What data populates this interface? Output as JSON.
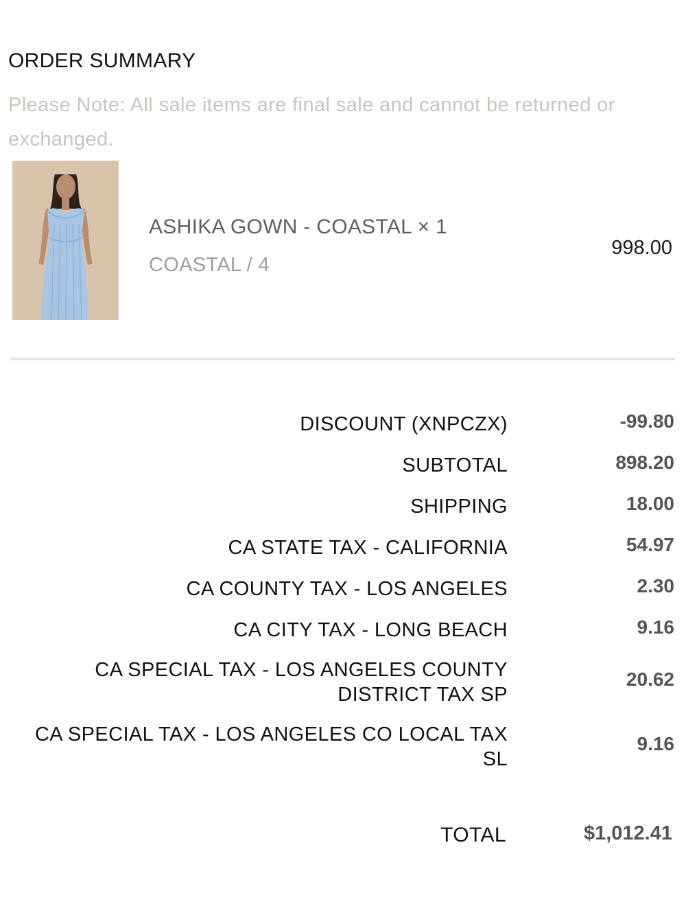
{
  "order_summary": {
    "title": "ORDER SUMMARY",
    "note": "Please Note: All sale items are final sale and cannot be returned or exchanged."
  },
  "line_item": {
    "image_icon": "product-photo",
    "name": "ASHIKA GOWN - COASTAL × 1",
    "variant": "COASTAL / 4",
    "price": "998.00"
  },
  "summary": {
    "rows": [
      {
        "label": "DISCOUNT (XNPCZX)",
        "value": "-99.80"
      },
      {
        "label": "SUBTOTAL",
        "value": "898.20"
      },
      {
        "label": "SHIPPING",
        "value": "18.00"
      },
      {
        "label": "CA STATE TAX - CALIFORNIA",
        "value": "54.97"
      },
      {
        "label": "CA COUNTY TAX - LOS ANGELES",
        "value": "2.30"
      },
      {
        "label": "CA CITY TAX - LONG BEACH",
        "value": "9.16"
      },
      {
        "label": "CA SPECIAL TAX - LOS ANGELES COUNTY DISTRICT TAX SP",
        "value": "20.62"
      },
      {
        "label": "CA SPECIAL TAX - LOS ANGELES CO LOCAL TAX SL",
        "value": "9.16"
      }
    ],
    "total_label": "TOTAL",
    "total_value": "$1,012.41"
  }
}
